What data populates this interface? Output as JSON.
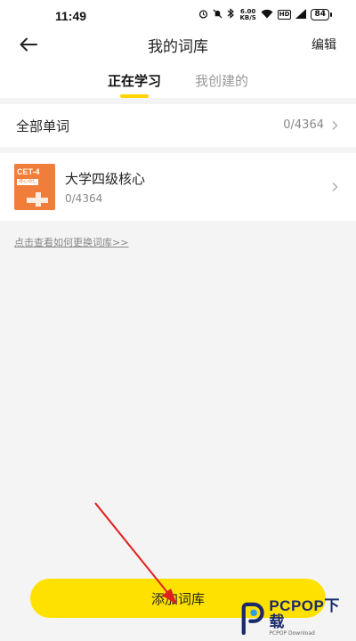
{
  "status_bar": {
    "time": "11:49",
    "net_speed": "6.00",
    "net_unit": "KB/S",
    "hd": "HD",
    "battery": "84"
  },
  "header": {
    "title": "我的词库",
    "edit_label": "编辑"
  },
  "tabs": [
    {
      "label": "正在学习",
      "active": true
    },
    {
      "label": "我创建的",
      "active": false
    }
  ],
  "all_words": {
    "label": "全部单词",
    "count": "0/4364"
  },
  "book": {
    "cover_title": "CET-4",
    "cover_subtitle": "核心词汇",
    "name": "大学四级核心",
    "progress": "0/4364"
  },
  "help_link": "点击查看如何更换词库>>",
  "add_button": "添加词库",
  "watermark": {
    "main": "PCPOP下载",
    "sub": "PCPOP Download"
  },
  "colors": {
    "accent": "#ffe100",
    "tab_indicator": "#ffd400",
    "cover": "#f07d3a",
    "annotation_arrow": "#e0201c"
  }
}
